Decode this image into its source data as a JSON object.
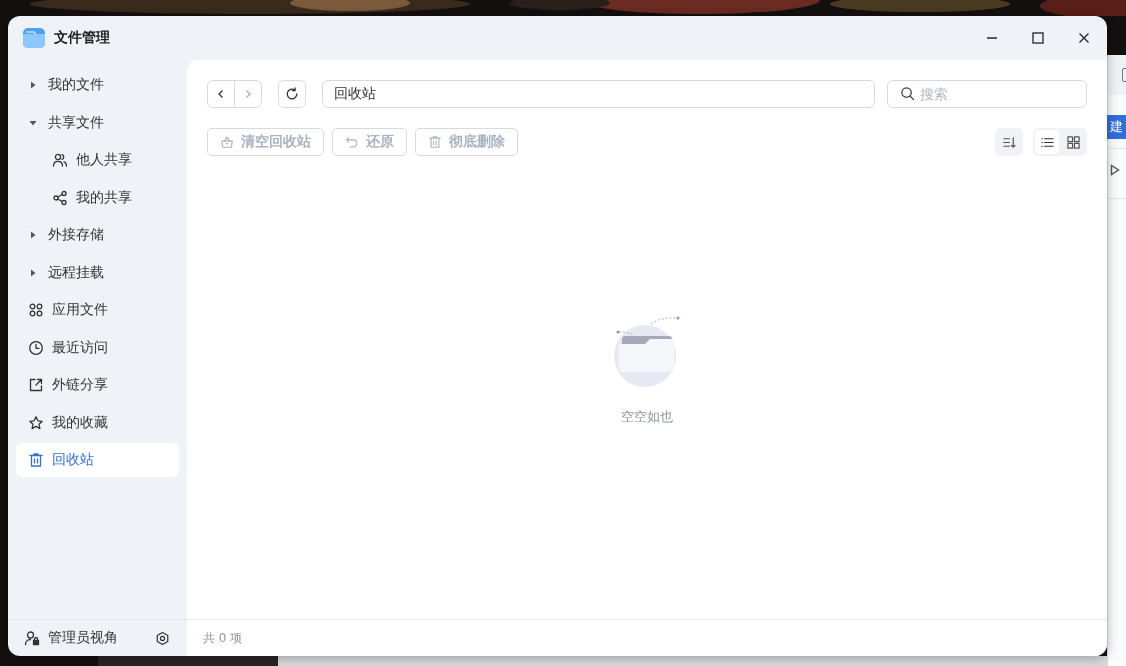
{
  "window": {
    "title": "文件管理"
  },
  "sidebar": {
    "items": [
      {
        "label": "我的文件",
        "kind": "expander",
        "expanded": false,
        "selected": false
      },
      {
        "label": "共享文件",
        "kind": "expander",
        "expanded": true,
        "selected": false,
        "children": [
          {
            "label": "他人共享",
            "kind": "icon",
            "selected": false
          },
          {
            "label": "我的共享",
            "kind": "icon",
            "selected": false
          }
        ]
      },
      {
        "label": "外接存储",
        "kind": "expander",
        "expanded": false,
        "selected": false
      },
      {
        "label": "远程挂载",
        "kind": "expander",
        "expanded": false,
        "selected": false
      },
      {
        "label": "应用文件",
        "kind": "icon",
        "selected": false
      },
      {
        "label": "最近访问",
        "kind": "icon",
        "selected": false
      },
      {
        "label": "外链分享",
        "kind": "icon",
        "selected": false
      },
      {
        "label": "我的收藏",
        "kind": "icon",
        "selected": false
      },
      {
        "label": "回收站",
        "kind": "icon",
        "selected": true
      }
    ],
    "footer": {
      "label": "管理员视角"
    }
  },
  "path": "回收站",
  "search": {
    "placeholder": "搜索"
  },
  "actions": [
    {
      "label": "清空回收站",
      "disabled": true
    },
    {
      "label": "还原",
      "disabled": true
    },
    {
      "label": "彻底删除",
      "disabled": true
    }
  ],
  "view_modes": [
    {
      "kind": "list",
      "selected": true
    },
    {
      "kind": "grid",
      "selected": false
    }
  ],
  "empty_message": "空空如也",
  "status_bar": "共 0 项",
  "background_window": {
    "button": "建"
  }
}
